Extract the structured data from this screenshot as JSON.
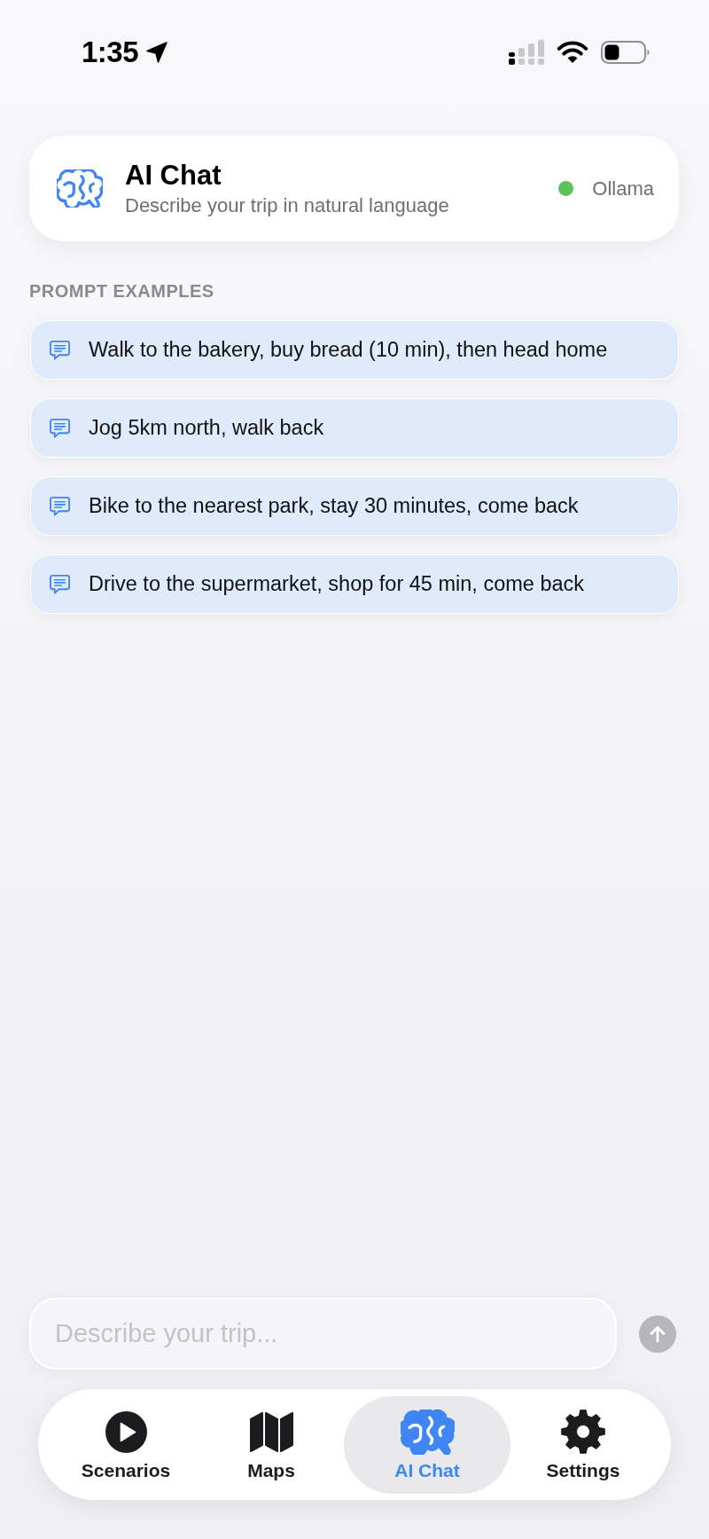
{
  "status_bar": {
    "time": "1:35"
  },
  "header": {
    "title": "AI Chat",
    "subtitle": "Describe your trip in natural language",
    "provider": {
      "name": "Ollama",
      "online": true
    }
  },
  "prompt_examples": {
    "heading": "PROMPT EXAMPLES",
    "items": [
      "Walk to the bakery, buy bread (10 min), then head home",
      "Jog 5km north, walk back",
      "Bike to the nearest park, stay 30 minutes, come back",
      "Drive to the supermarket, shop for 45 min, come back"
    ]
  },
  "composer": {
    "placeholder": "Describe your trip...",
    "send": {
      "disabled": true
    }
  },
  "tab_bar": {
    "tabs": [
      {
        "label": "Scenarios",
        "kind": "play",
        "selected": false
      },
      {
        "label": "Maps",
        "kind": "map",
        "selected": false
      },
      {
        "label": "AI Chat",
        "kind": "brain",
        "selected": true
      },
      {
        "label": "Settings",
        "kind": "gear",
        "selected": false
      }
    ]
  }
}
